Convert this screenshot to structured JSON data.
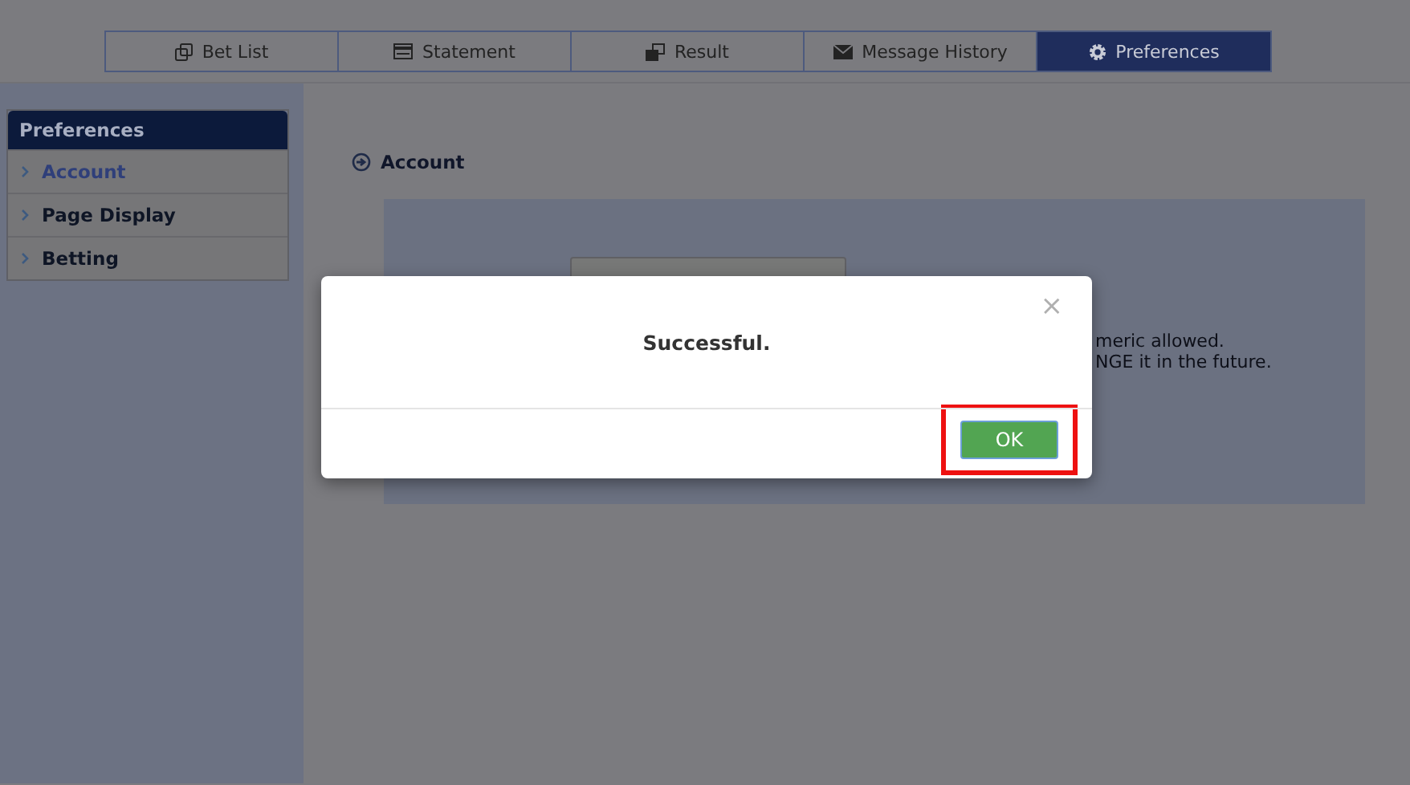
{
  "tabs": [
    {
      "label": "Bet List",
      "kind": "copy",
      "selected": false
    },
    {
      "label": "Statement",
      "kind": "card",
      "selected": false
    },
    {
      "label": "Result",
      "kind": "windows",
      "selected": false
    },
    {
      "label": "Message History",
      "kind": "envelope",
      "selected": false
    },
    {
      "label": "Preferences",
      "kind": "gear",
      "selected": true
    }
  ],
  "sidebar": {
    "title": "Preferences",
    "items": [
      {
        "label": "Account",
        "selected": true
      },
      {
        "label": "Page Display",
        "selected": false
      },
      {
        "label": "Betting",
        "selected": false
      }
    ]
  },
  "section": {
    "title": "Account",
    "notes": [
      "meric allowed.",
      "NGE it in the future."
    ]
  },
  "dialog": {
    "message": "Successful.",
    "close": "×",
    "button": "OK"
  }
}
